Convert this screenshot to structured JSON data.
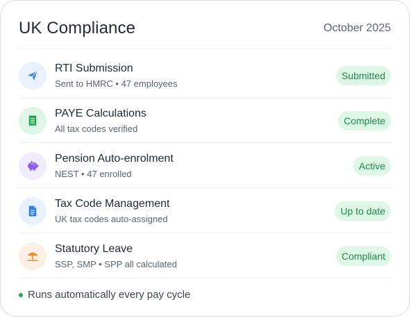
{
  "header": {
    "title": "UK Compliance",
    "date": "October 2025"
  },
  "items": [
    {
      "icon": "paper-plane-icon",
      "title": "RTI Submission",
      "subtitle": "Sent to HMRC • 47 employees",
      "status": "Submitted"
    },
    {
      "icon": "receipt-icon",
      "title": "PAYE Calculations",
      "subtitle": "All tax codes verified",
      "status": "Complete"
    },
    {
      "icon": "piggy-bank-icon",
      "title": "Pension Auto-enrolment",
      "subtitle": "NEST • 47 enrolled",
      "status": "Active"
    },
    {
      "icon": "document-icon",
      "title": "Tax Code Management",
      "subtitle": "UK tax codes auto-assigned",
      "status": "Up to date"
    },
    {
      "icon": "beach-umbrella-icon",
      "title": "Statutory Leave",
      "subtitle": "SSP, SMP • SPP all calculated",
      "status": "Compliant"
    }
  ],
  "footer": {
    "text": "Runs automatically every pay cycle"
  },
  "colors": {
    "badge_bg": "#dff7e7",
    "badge_text": "#1f8a4c",
    "blue_icon": "#2f7fe6",
    "green_icon": "#22a653",
    "purple_icon": "#8b5cf6",
    "orange_icon": "#f08a24"
  }
}
